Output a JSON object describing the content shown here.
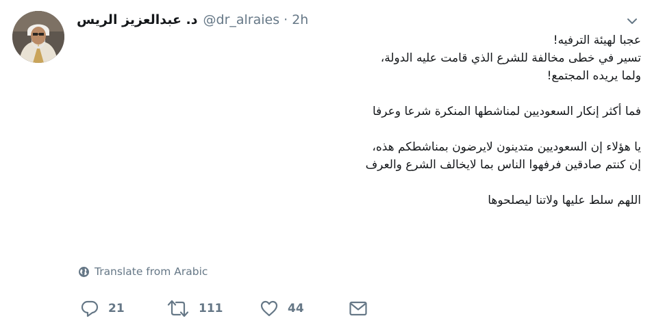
{
  "tweet": {
    "display_name": "د. عبدالعزيز الريس",
    "handle": "@dr_alraies",
    "separator": "·",
    "time": "2h",
    "lines": [
      "عجبا لهيئة الترفيه!",
      "تسير في خطى مخالفة للشرع الذي قامت عليه الدولة،",
      "ولما يريده المجتمع!",
      "",
      "فما أكثر إنكار السعوديين لمناشطها المنكرة شرعا وعرفا",
      "",
      "يا هؤلاء إن السعوديين متدينون لايرضون بمناشطكم هذه،",
      "إن كنتم صادقين فرفهوا الناس بما لايخالف الشرع والعرف",
      "",
      "اللهم سلط عليها ولاتنا ليصلحوها"
    ],
    "translate_label": "Translate from Arabic",
    "replies": "21",
    "retweets": "111",
    "likes": "44"
  },
  "icons": {
    "chevron": "chevron-down-icon",
    "globe": "globe-icon",
    "reply": "reply-icon",
    "retweet": "retweet-icon",
    "like": "heart-icon",
    "message": "envelope-icon"
  },
  "colors": {
    "text": "#14171a",
    "secondary": "#657786",
    "background": "#ffffff"
  }
}
